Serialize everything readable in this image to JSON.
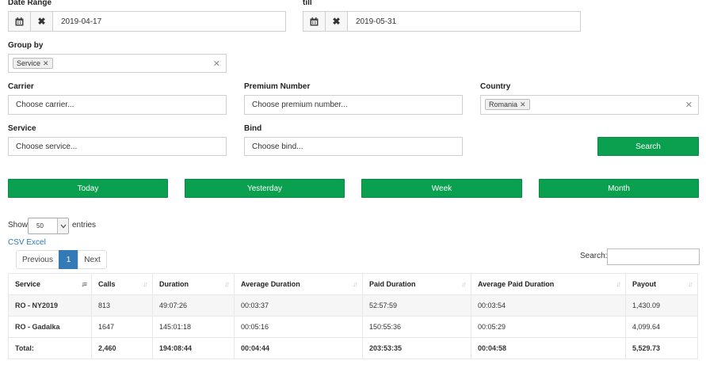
{
  "filters": {
    "date_range_label": "Date Range",
    "date_from": "2019-04-17",
    "till_label": "till",
    "date_to": "2019-05-31",
    "group_by_label": "Group by",
    "group_by_tag": "Service",
    "carrier_label": "Carrier",
    "carrier_placeholder": "Choose carrier...",
    "premium_label": "Premium Number",
    "premium_placeholder": "Choose premium number...",
    "country_label": "Country",
    "country_tag": "Romania",
    "service_label": "Service",
    "service_placeholder": "Choose service...",
    "bind_label": "Bind",
    "bind_placeholder": "Choose bind...",
    "search_button": "Search"
  },
  "quick_ranges": [
    "Today",
    "Yesterday",
    "Week",
    "Month"
  ],
  "table_controls": {
    "show_label": "Show",
    "entries_value": "50",
    "entries_label": "entries",
    "csv_label": "CSV",
    "excel_label": "Excel",
    "previous": "Previous",
    "current_page": "1",
    "next": "Next",
    "search_label": "Search:"
  },
  "table": {
    "columns": [
      "Service",
      "Calls",
      "Duration",
      "Average Duration",
      "Paid Duration",
      "Average Paid Duration",
      "Payout"
    ],
    "rows": [
      [
        "RO - NY2019",
        "813",
        "49:07:26",
        "00:03:37",
        "52:57:59",
        "00:03:54",
        "1,430.09"
      ],
      [
        "RO - Gadalka",
        "1647",
        "145:01:18",
        "00:05:16",
        "150:55:36",
        "00:05:29",
        "4,099.64"
      ]
    ],
    "total": [
      "Total:",
      "2,460",
      "194:08:44",
      "00:04:44",
      "203:53:35",
      "00:04:58",
      "5,529.73"
    ]
  },
  "colors": {
    "accent_green": "#0aa04f",
    "pager_active": "#337ab7",
    "link": "#2a7ab8"
  }
}
